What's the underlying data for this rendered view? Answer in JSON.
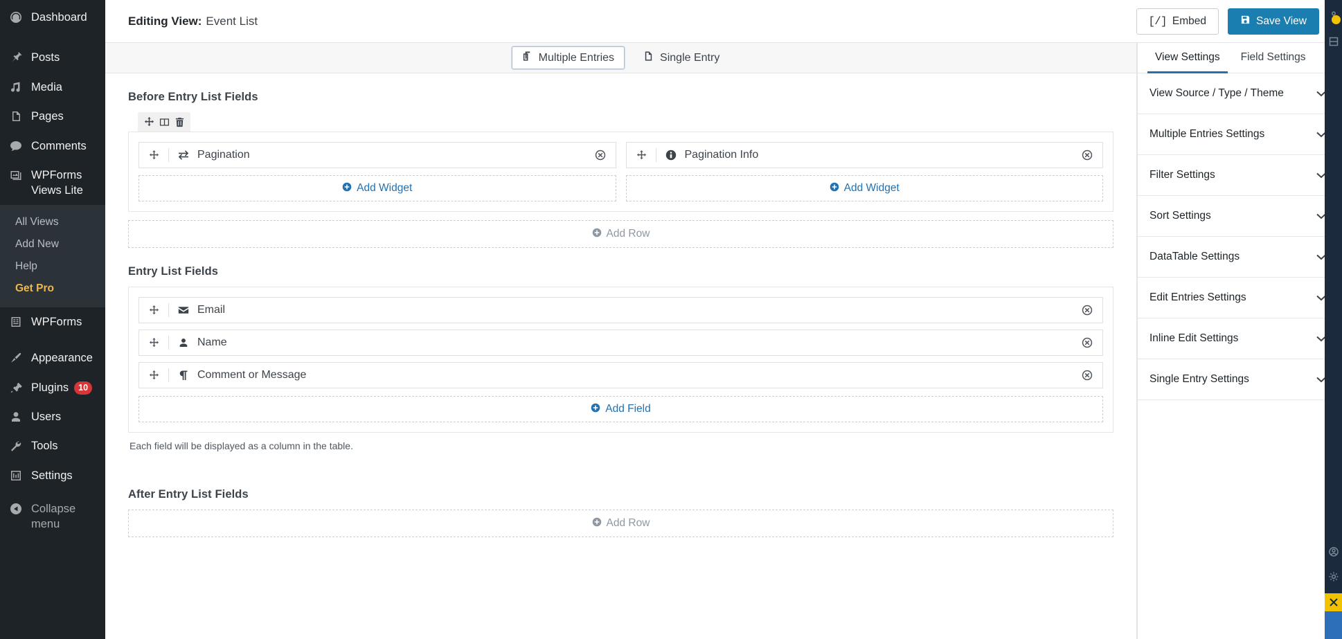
{
  "wp_sidebar": {
    "items": [
      {
        "label": "Dashboard",
        "icon": "dashboard-icon"
      },
      {
        "label": "Posts",
        "icon": "pin-icon"
      },
      {
        "label": "Media",
        "icon": "media-icon"
      },
      {
        "label": "Pages",
        "icon": "pages-icon"
      },
      {
        "label": "Comments",
        "icon": "comments-icon"
      },
      {
        "label": "WPForms Views Lite",
        "icon": "views-icon"
      }
    ],
    "submenu": [
      {
        "label": "All Views"
      },
      {
        "label": "Add New"
      },
      {
        "label": "Help"
      },
      {
        "label": "Get Pro"
      }
    ],
    "items_after": [
      {
        "label": "WPForms",
        "icon": "wpforms-icon"
      },
      {
        "label": "Appearance",
        "icon": "brush-icon"
      },
      {
        "label": "Plugins",
        "icon": "plug-icon",
        "badge": "10"
      },
      {
        "label": "Users",
        "icon": "user-icon"
      },
      {
        "label": "Tools",
        "icon": "wrench-icon"
      },
      {
        "label": "Settings",
        "icon": "sliders-icon"
      }
    ],
    "collapse": {
      "label": "Collapse menu",
      "icon": "collapse-icon"
    }
  },
  "topbar": {
    "title_label": "Editing View:",
    "title_value": "Event List",
    "embed_bracket": "[/]",
    "embed_label": "Embed",
    "save_label": "Save View"
  },
  "tabs": [
    {
      "label": "Multiple Entries",
      "icon": "copy-icon",
      "active": true
    },
    {
      "label": "Single Entry",
      "icon": "file-icon",
      "active": false
    }
  ],
  "canvas": {
    "before_section": {
      "title": "Before Entry List Fields",
      "row_toolbar": [
        {
          "icon": "move-icon",
          "name": "move-row"
        },
        {
          "icon": "columns-icon",
          "name": "row-layout"
        },
        {
          "icon": "trash-icon",
          "name": "delete-row"
        }
      ],
      "columns": [
        {
          "widget": {
            "label": "Pagination",
            "icon": "exchange-icon"
          },
          "add_widget_label": "Add Widget"
        },
        {
          "widget": {
            "label": "Pagination Info",
            "icon": "info-icon"
          },
          "add_widget_label": "Add Widget"
        }
      ],
      "add_row_label": "Add Row"
    },
    "entry_section": {
      "title": "Entry List Fields",
      "fields": [
        {
          "label": "Email",
          "icon": "envelope-icon"
        },
        {
          "label": "Name",
          "icon": "user-icon"
        },
        {
          "label": "Comment or Message",
          "icon": "paragraph-icon"
        }
      ],
      "add_field_label": "Add Field",
      "helper_text": "Each field will be displayed as a column in the table."
    },
    "after_section": {
      "title": "After Entry List Fields",
      "add_row_label": "Add Row"
    }
  },
  "settings": {
    "tabs": [
      {
        "label": "View Settings",
        "active": true
      },
      {
        "label": "Field Settings",
        "active": false
      }
    ],
    "accordion": [
      {
        "label": "View Source / Type / Theme"
      },
      {
        "label": "Multiple Entries Settings"
      },
      {
        "label": "Filter Settings"
      },
      {
        "label": "Sort Settings"
      },
      {
        "label": "DataTable Settings"
      },
      {
        "label": "Edit Entries Settings"
      },
      {
        "label": "Inline Edit Settings"
      },
      {
        "label": "Single Entry Settings"
      }
    ]
  },
  "right_rail": {
    "icons": [
      {
        "name": "pin-marker-icon"
      },
      {
        "name": "layout-panel-icon"
      }
    ],
    "bottom_icons": [
      {
        "name": "account-circle-icon"
      },
      {
        "name": "gear-icon"
      }
    ],
    "highlight": {
      "name": "expand-arrows-icon"
    }
  },
  "colors": {
    "accent_blue": "#2271b1",
    "primary_button": "#1a7eb0",
    "sidebar_bg": "#1d2327",
    "submenu_bg": "#2c3338",
    "pro_gold": "#f0b849",
    "badge_red": "#d63638",
    "rail_dark": "#1b2a3d",
    "rail_yellow": "#f2c200"
  }
}
